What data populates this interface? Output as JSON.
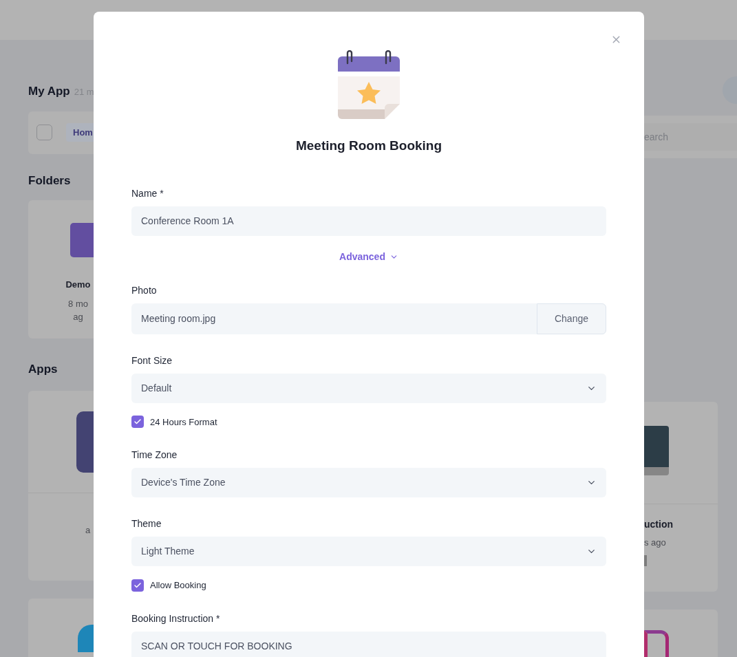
{
  "background": {
    "title": "My App",
    "count": "21 m",
    "select_all_checked": false,
    "tag": "Hom",
    "search_placeholder": "earch",
    "sections": [
      "Folders",
      "Apps"
    ],
    "folder": {
      "name": "Demo",
      "time_lines": [
        "8 mo",
        "ag"
      ]
    },
    "app_cards": [
      {
        "time": "a"
      },
      {
        "name": "uction",
        "time": "s ago"
      }
    ]
  },
  "modal": {
    "title": "Meeting Room Booking",
    "fields": [
      {
        "kind": "text",
        "label": "Name *",
        "value": "Conference Room 1A"
      },
      {
        "kind": "toggle",
        "label": "Advanced",
        "expanded": true
      },
      {
        "kind": "file",
        "label": "Photo",
        "value": "Meeting room.jpg",
        "button": "Change"
      },
      {
        "kind": "select",
        "label": "Font Size",
        "value": "Default"
      },
      {
        "kind": "checkbox",
        "label": "24 Hours Format",
        "checked": true
      },
      {
        "kind": "select",
        "label": "Time Zone",
        "value": "Device's Time Zone"
      },
      {
        "kind": "select",
        "label": "Theme",
        "value": "Light Theme"
      },
      {
        "kind": "checkbox",
        "label": "Allow Booking",
        "checked": true
      },
      {
        "kind": "text",
        "label": "Booking Instruction *",
        "value": "SCAN OR TOUCH FOR BOOKING"
      }
    ]
  }
}
